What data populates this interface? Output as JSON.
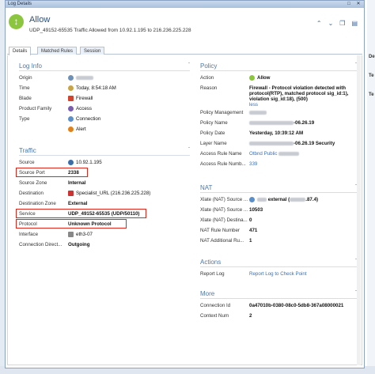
{
  "window": {
    "title": "Log Details"
  },
  "header": {
    "title": "Allow",
    "subtitle": "UDP_49152-65535 Traffic Allowed from 10.92.1.195 to 216.236.225.228"
  },
  "tabs": [
    "Details",
    "Matched Rules",
    "Session"
  ],
  "right_strip": [
    "De",
    "Te",
    "Te"
  ],
  "log_info": {
    "title": "Log Info",
    "rows": [
      {
        "label": "Origin",
        "value": ""
      },
      {
        "label": "Time",
        "value": "Today, 8:54:18 AM"
      },
      {
        "label": "Blade",
        "value": "Firewall"
      },
      {
        "label": "Product Family",
        "value": "Access"
      },
      {
        "label": "Type",
        "value": "Connection"
      },
      {
        "label": "",
        "value": "Alert"
      }
    ]
  },
  "traffic": {
    "title": "Traffic",
    "rows": [
      {
        "label": "Source",
        "value": "10.92.1.195"
      },
      {
        "label": "Source Port",
        "value": "2338"
      },
      {
        "label": "Source Zone",
        "value": "Internal"
      },
      {
        "label": "Destination",
        "value": "Specialist_URL (216.236.225.228)"
      },
      {
        "label": "Destination Zone",
        "value": "External"
      },
      {
        "label": "Service",
        "value": "UDP_49152-65535 (UDP/50110)"
      },
      {
        "label": "Protocol",
        "value": "Unknown Protocol"
      },
      {
        "label": "Interface",
        "value": "eth3-07"
      },
      {
        "label": "Connection Direct...",
        "value": "Outgoing"
      }
    ]
  },
  "policy": {
    "title": "Policy",
    "action_label": "Action",
    "action_value": "Allow",
    "reason_label": "Reason",
    "reason_lines": [
      "Firewall - Protocol violation detected with",
      "protocol(RTP), matched protocol sig_id:1),",
      "violation sig_id:18), (500)"
    ],
    "reason_link": "less",
    "rows": [
      {
        "label": "Policy Management",
        "value": ""
      },
      {
        "label": "Policy Name",
        "value": "-06.26.19"
      },
      {
        "label": "Policy Date",
        "value": "Yesterday, 10:39:12 AM"
      },
      {
        "label": "Layer Name",
        "value": "-06.26.19 Security"
      },
      {
        "label": "Access Rule Name",
        "value": "Otbnd Public"
      },
      {
        "label": "Access Rule Numb...",
        "value": "339"
      }
    ]
  },
  "nat": {
    "title": "NAT",
    "rows": [
      {
        "label": "Xlate (NAT) Source ...",
        "value": "external (",
        "value_tail": ".87.4)"
      },
      {
        "label": "Xlate (NAT) Source ...",
        "value": "10503"
      },
      {
        "label": "Xlate (NAT) Destina...",
        "value": "0"
      },
      {
        "label": "NAT Rule Number",
        "value": "471"
      },
      {
        "label": "NAT Additional Ru...",
        "value": "1"
      }
    ]
  },
  "actions": {
    "title": "Actions",
    "label": "Report Log",
    "link": "Report Log to Check Point"
  },
  "more": {
    "title": "More",
    "rows": [
      {
        "label": "Connection Id",
        "value": "0a47010b-0380-08c0-5db8-367a08000021"
      },
      {
        "label": "Context Num",
        "value": "2"
      }
    ]
  },
  "colors": {
    "accent": "#4a78b0",
    "allow_green": "#8cc63e",
    "highlight_red": "#e0251b"
  }
}
